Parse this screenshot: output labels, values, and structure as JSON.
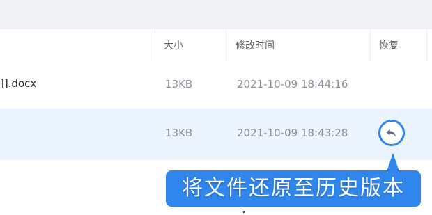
{
  "table": {
    "columns": {
      "size": "大小",
      "modified_time": "修改时间",
      "restore": "恢复"
    },
    "rows": [
      {
        "name": "]].docx",
        "size": "13KB",
        "time": "2021-10-09 18:44:16"
      },
      {
        "name": "",
        "size": "13KB",
        "time": "2021-10-09 18:43:28"
      }
    ]
  },
  "callout": {
    "text": "将文件还原至历史版本"
  },
  "colors": {
    "accent": "#2f86ec",
    "selected_row": "#eaf3fe",
    "header_bar": "#f1f2f6"
  },
  "icons": {
    "restore": "undo-arrow-icon"
  }
}
